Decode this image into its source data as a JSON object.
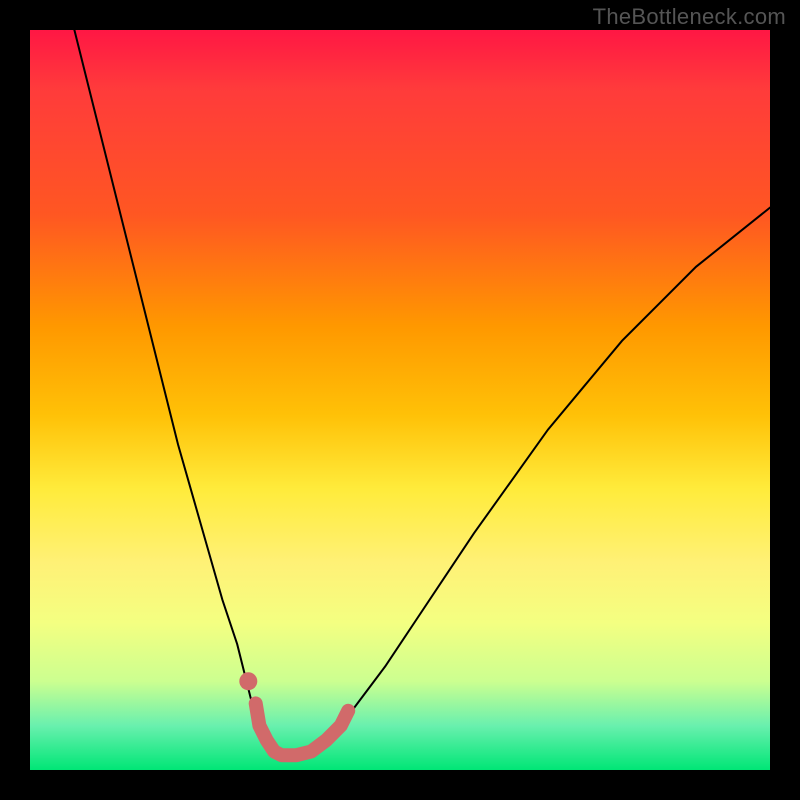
{
  "watermark": "TheBottleneck.com",
  "chart_data": {
    "type": "line",
    "title": "",
    "xlabel": "",
    "ylabel": "",
    "xlim": [
      0,
      100
    ],
    "ylim": [
      0,
      100
    ],
    "series": [
      {
        "name": "black-curve",
        "color": "#000000",
        "stroke_width": 2,
        "points": [
          {
            "x": 6,
            "y": 100
          },
          {
            "x": 8,
            "y": 92
          },
          {
            "x": 10,
            "y": 84
          },
          {
            "x": 12,
            "y": 76
          },
          {
            "x": 14,
            "y": 68
          },
          {
            "x": 16,
            "y": 60
          },
          {
            "x": 18,
            "y": 52
          },
          {
            "x": 20,
            "y": 44
          },
          {
            "x": 22,
            "y": 37
          },
          {
            "x": 24,
            "y": 30
          },
          {
            "x": 26,
            "y": 23
          },
          {
            "x": 28,
            "y": 17
          },
          {
            "x": 29,
            "y": 13
          },
          {
            "x": 30,
            "y": 9
          },
          {
            "x": 31,
            "y": 6
          },
          {
            "x": 32,
            "y": 4
          },
          {
            "x": 33,
            "y": 2.5
          },
          {
            "x": 34,
            "y": 2
          },
          {
            "x": 36,
            "y": 2
          },
          {
            "x": 38,
            "y": 2.5
          },
          {
            "x": 40,
            "y": 4
          },
          {
            "x": 42,
            "y": 6
          },
          {
            "x": 45,
            "y": 10
          },
          {
            "x": 48,
            "y": 14
          },
          {
            "x": 52,
            "y": 20
          },
          {
            "x": 56,
            "y": 26
          },
          {
            "x": 60,
            "y": 32
          },
          {
            "x": 65,
            "y": 39
          },
          {
            "x": 70,
            "y": 46
          },
          {
            "x": 75,
            "y": 52
          },
          {
            "x": 80,
            "y": 58
          },
          {
            "x": 85,
            "y": 63
          },
          {
            "x": 90,
            "y": 68
          },
          {
            "x": 95,
            "y": 72
          },
          {
            "x": 100,
            "y": 76
          }
        ]
      },
      {
        "name": "pink-highlight",
        "color": "#d16a6a",
        "stroke_width": 14,
        "points": [
          {
            "x": 30.5,
            "y": 9
          },
          {
            "x": 31,
            "y": 6
          },
          {
            "x": 32,
            "y": 4
          },
          {
            "x": 33,
            "y": 2.5
          },
          {
            "x": 34,
            "y": 2
          },
          {
            "x": 36,
            "y": 2
          },
          {
            "x": 38,
            "y": 2.5
          },
          {
            "x": 40,
            "y": 4
          },
          {
            "x": 42,
            "y": 6
          },
          {
            "x": 43,
            "y": 8
          }
        ]
      }
    ],
    "markers": [
      {
        "name": "pink-dot",
        "x": 29.5,
        "y": 12,
        "r": 9,
        "color": "#d16a6a"
      }
    ]
  }
}
